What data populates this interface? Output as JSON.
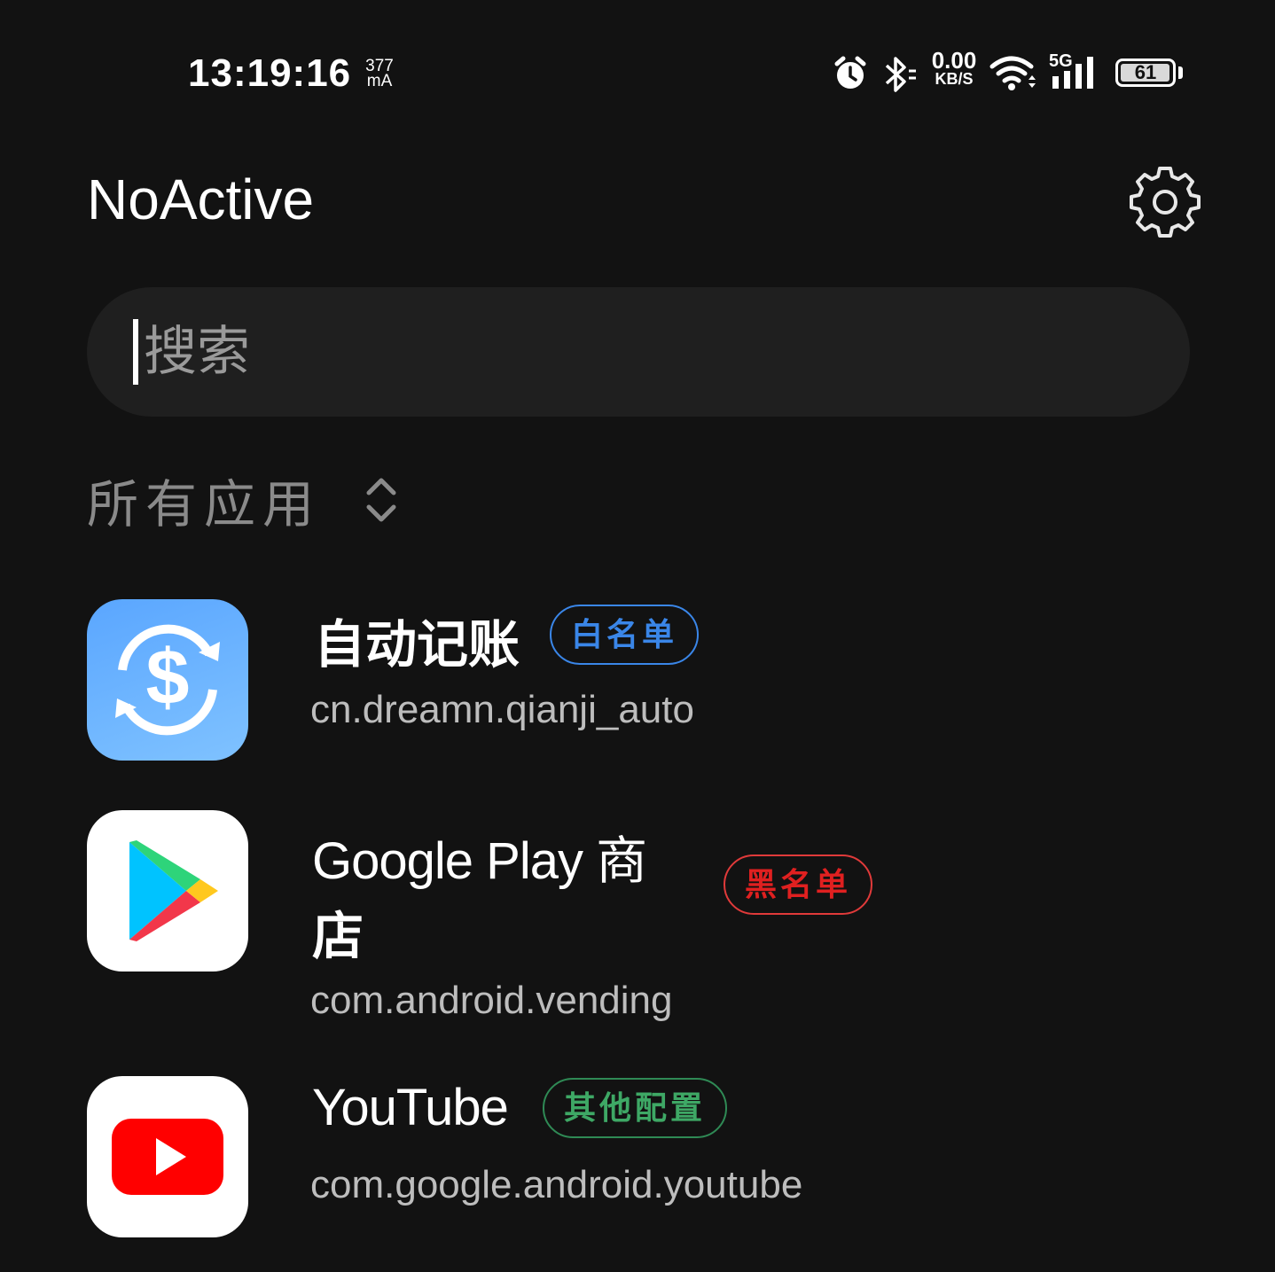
{
  "status_bar": {
    "time": "13:19:16",
    "current_value": "377",
    "current_unit": "mA",
    "net_speed_value": "0.00",
    "net_speed_unit": "KB/S",
    "network_type": "5G",
    "battery_level": "61",
    "icons": [
      "alarm-icon",
      "bluetooth-icon",
      "wifi-icon",
      "cellular-signal-icon",
      "battery-icon"
    ]
  },
  "header": {
    "title": "NoActive",
    "settings_icon": "gear-icon"
  },
  "search": {
    "placeholder": "搜索",
    "value": ""
  },
  "filter": {
    "label": "所有应用",
    "icon": "sort-toggle-icon"
  },
  "apps": [
    {
      "name": "自动记账",
      "package": "cn.dreamn.qianji_auto",
      "tag": "白名单",
      "tag_color": "#3a86e8",
      "icon": "dollar-sync-icon"
    },
    {
      "name_line1": "Google Play 商",
      "name_line2": "店",
      "package": "com.android.vending",
      "tag": "黑名单",
      "tag_color": "#e02020",
      "icon": "google-play-icon"
    },
    {
      "name": "YouTube",
      "package": "com.google.android.youtube",
      "tag": "其他配置",
      "tag_color": "#3ea865",
      "icon": "youtube-icon"
    }
  ],
  "colors": {
    "background": "#121212",
    "search_background": "#1f1f1f",
    "accent_white_list": "#3a86e8",
    "accent_black_list": "#e02020",
    "accent_other": "#3ea865"
  }
}
